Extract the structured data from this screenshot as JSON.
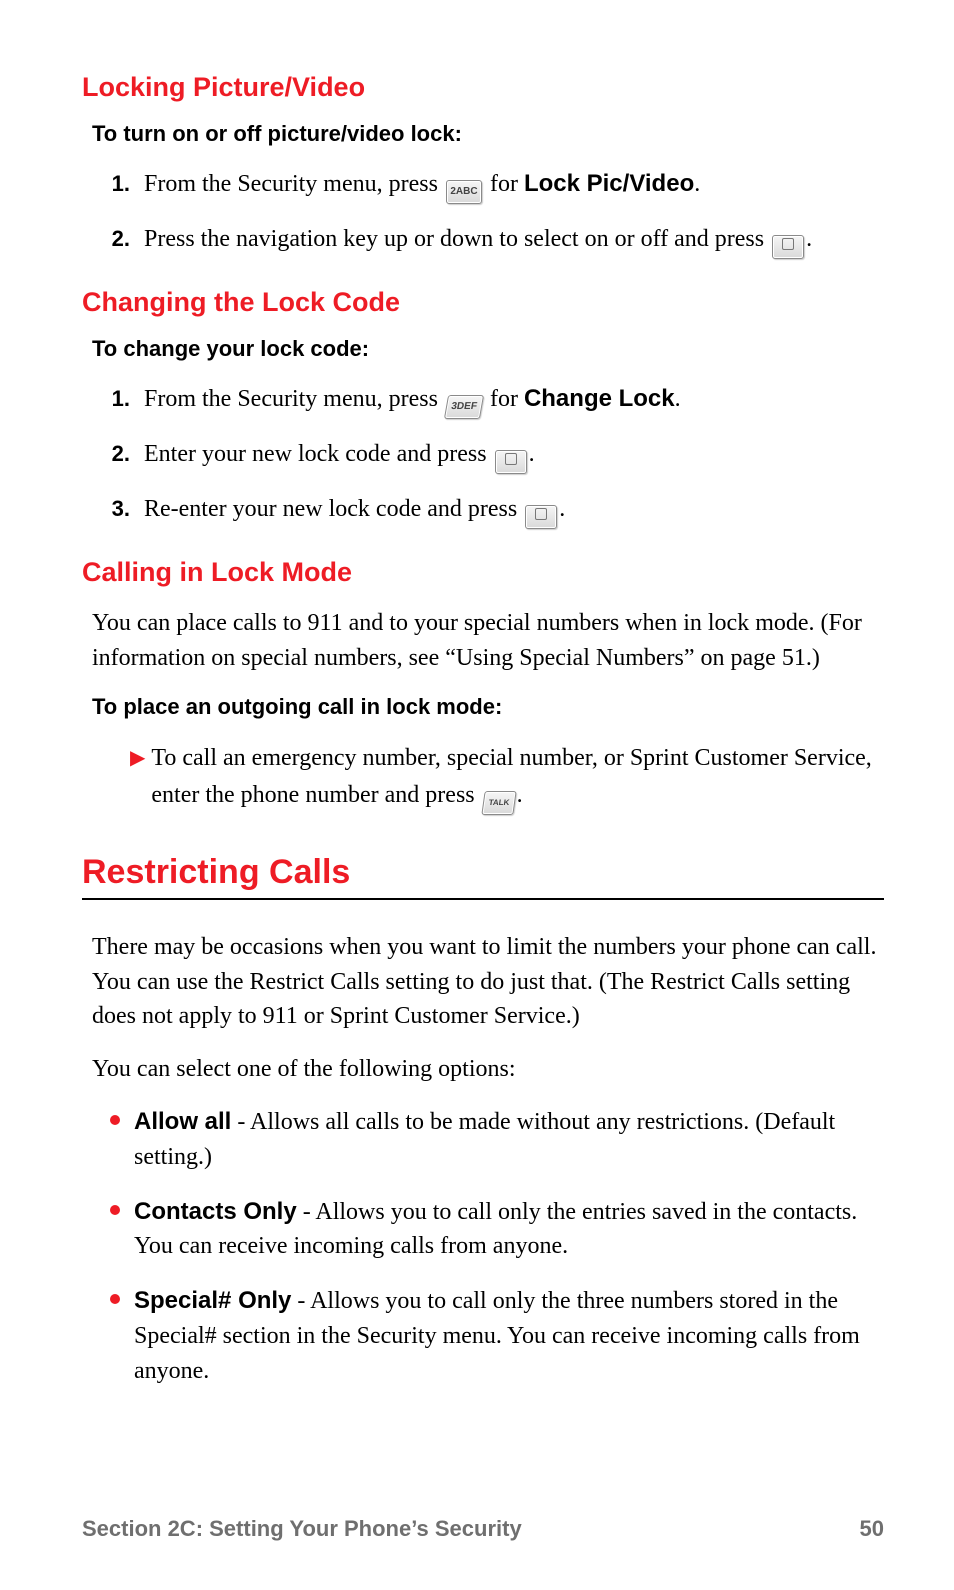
{
  "sections": {
    "lockPic": {
      "heading": "Locking Picture/Video",
      "lead": "To turn on or off picture/video lock:",
      "step1_a": "From the Security menu, press ",
      "step1_key": "2ABC",
      "step1_b": " for ",
      "step1_bold": "Lock Pic/Video",
      "step1_c": ".",
      "step2_a": "Press the navigation key up or down to select on or off and press ",
      "step2_b": "."
    },
    "changeCode": {
      "heading": "Changing the Lock Code",
      "lead": "To change your lock code:",
      "step1_a": "From the Security menu, press ",
      "step1_key": "3DEF",
      "step1_b": " for ",
      "step1_bold": "Change Lock",
      "step1_c": ".",
      "step2_a": "Enter your new lock code and press ",
      "step2_b": ".",
      "step3_a": "Re-enter your new lock code and press ",
      "step3_b": "."
    },
    "callLock": {
      "heading": "Calling in Lock Mode",
      "para": "You can place calls to 911 and to your special numbers when in lock mode. (For information on special numbers, see “Using Special Numbers” on page 51.)",
      "lead": "To place an outgoing call in lock mode:",
      "bullet_a": "To call an emergency number, special number, or Sprint Customer Service, enter the phone number and press ",
      "bullet_b": "."
    },
    "restrict": {
      "heading": "Restricting Calls",
      "para1": "There may be occasions when you want to limit the numbers your phone can call. You can use the Restrict Calls setting to do just that. (The Restrict Calls setting does not apply to 911 or Sprint Customer Service.)",
      "para2": "You can select one of the following options:",
      "opt1_label": "Allow all",
      "opt1_text": " - Allows all calls to be made without any restrictions. (Default setting.)",
      "opt2_label": "Contacts Only",
      "opt2_text": " - Allows you to call only the entries saved in the contacts. You can receive incoming calls from anyone.",
      "opt3_label": "Special# Only",
      "opt3_text": " - Allows you to call only the three numbers stored in the Special# section in the Security menu. You can receive incoming calls from anyone."
    }
  },
  "list_numbers": {
    "n1": "1.",
    "n2": "2.",
    "n3": "3."
  },
  "icons": {
    "talk": "TALK"
  },
  "footer": {
    "section": "Section 2C: Setting Your Phone’s Security",
    "page": "50"
  }
}
